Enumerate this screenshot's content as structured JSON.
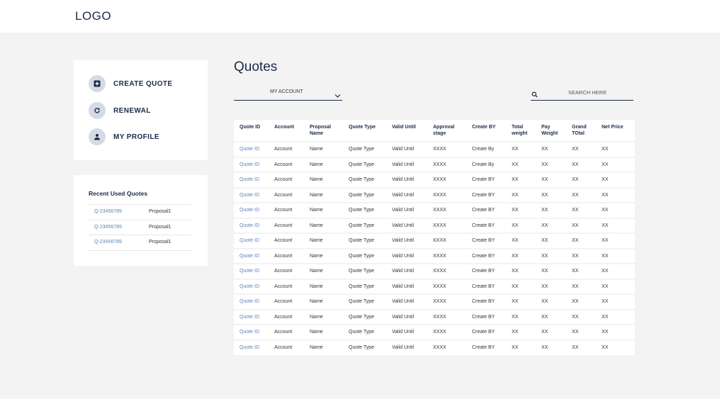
{
  "header": {
    "logo": "LOGO"
  },
  "nav": {
    "items": [
      {
        "label": "CREATE QUOTE",
        "icon": "add-box-icon"
      },
      {
        "label": "RENEWAL",
        "icon": "refresh-icon"
      },
      {
        "label": "MY PROFILE",
        "icon": "person-icon"
      }
    ]
  },
  "recent": {
    "title": "Recent Used Quotes",
    "items": [
      {
        "id": "Q-23456789",
        "name": "Proposal1"
      },
      {
        "id": "Q-23456789",
        "name": "Proposal1"
      },
      {
        "id": "Q-23456789",
        "name": "Proposal1"
      }
    ]
  },
  "main": {
    "title": "Quotes",
    "account_select": {
      "value": "MY ACCOUNT"
    },
    "search": {
      "placeholder": "SEARCH HERE"
    }
  },
  "table": {
    "columns": [
      "Quote ID",
      "Account",
      "Proposal Name",
      "Quote Type",
      "Valid Until",
      "Approval stage",
      "Create BY",
      "Total weight",
      "Pay Weight",
      "Grand TOtal",
      "Net Price"
    ],
    "rows": [
      [
        "Quote ID",
        "Account",
        "Name",
        "Quote Type",
        "Valid Until",
        "XXXX",
        "Create By",
        "XX",
        "XX",
        "XX",
        "XX"
      ],
      [
        "Quote ID",
        "Account",
        "Name",
        "Quote Type",
        "Valid Until",
        "XXXX",
        "Create By",
        "XX",
        "XX",
        "XX",
        "XX"
      ],
      [
        "Quote ID",
        "Account",
        "Name",
        "Quote Type",
        "Valid Until",
        "XXXX",
        "Create BY",
        "XX",
        "XX",
        "XX",
        "XX"
      ],
      [
        "Quote ID",
        "Account",
        "Name",
        "Quote Type",
        "Valid Until",
        "XXXX",
        "Create BY",
        "XX",
        "XX",
        "XX",
        "XX"
      ],
      [
        "Quote ID",
        "Account",
        "Name",
        "Quote Type",
        "Valid Until",
        "XXXX",
        "Create BY",
        "XX",
        "XX",
        "XX",
        "XX"
      ],
      [
        "Quote ID",
        "Account",
        "Name",
        "Quote Type",
        "Valid Until",
        "XXXX",
        "Create BY",
        "XX",
        "XX",
        "XX",
        "XX"
      ],
      [
        "Quote ID",
        "Account",
        "Name",
        "Quote Type",
        "Valid Until",
        "XXXX",
        "Create BY",
        "XX",
        "XX",
        "XX",
        "XX"
      ],
      [
        "Quote ID",
        "Account",
        "Name",
        "Quote Type",
        "Valid Until",
        "XXXX",
        "Create BY",
        "XX",
        "XX",
        "XX",
        "XX"
      ],
      [
        "Quote ID",
        "Account",
        "Name",
        "Quote Type",
        "Valid Until",
        "XXXX",
        "Create BY",
        "XX",
        "XX",
        "XX",
        "XX"
      ],
      [
        "Quote ID",
        "Account",
        "Name",
        "Quote Type",
        "Valid Until",
        "XXXX",
        "Create BY",
        "XX",
        "XX",
        "XX",
        "XX"
      ],
      [
        "Quote ID",
        "Account",
        "Name",
        "Quote Type",
        "Valid Until",
        "XXXX",
        "Create BY",
        "XX",
        "XX",
        "XX",
        "XX"
      ],
      [
        "Quote ID",
        "Account",
        "Name",
        "Quote Type",
        "Valid Until",
        "XXXX",
        "Create BY",
        "XX",
        "XX",
        "XX",
        "XX"
      ],
      [
        "Quote ID",
        "Account",
        "Name",
        "Quote Type",
        "Valid Until",
        "XXXX",
        "Create BY",
        "XX",
        "XX",
        "XX",
        "XX"
      ],
      [
        "Quote ID",
        "Account",
        "Name",
        "Quote Type",
        "Valid Until",
        "XXXX",
        "Create BY",
        "XX",
        "XX",
        "XX",
        "XX"
      ]
    ]
  },
  "colors": {
    "primary": "#1c2b4a",
    "link": "#5b84b8",
    "background": "#f3f3f3",
    "icon_bg": "#d5dbe5"
  }
}
